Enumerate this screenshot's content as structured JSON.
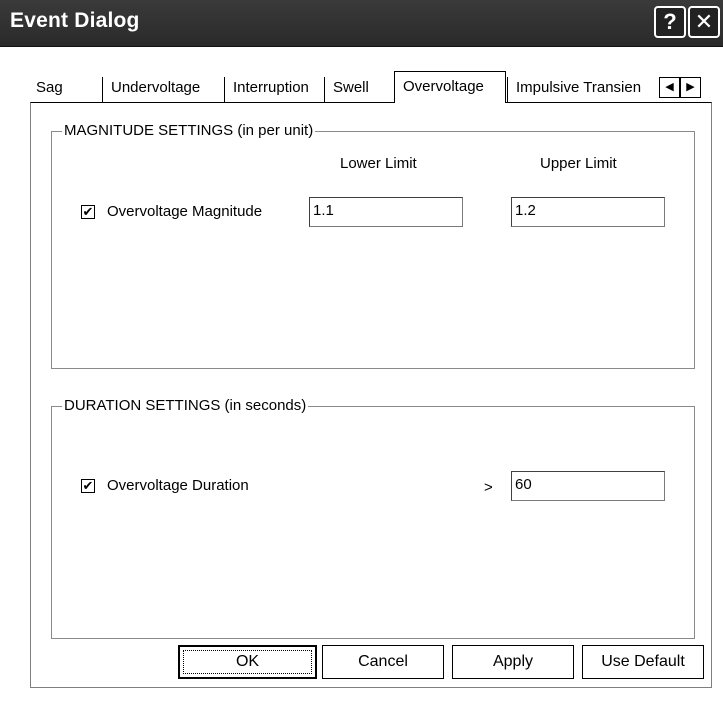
{
  "window": {
    "title": "Event Dialog",
    "help_glyph": "?",
    "close_glyph": "✕"
  },
  "tabs": [
    {
      "label": "Sag",
      "active": false
    },
    {
      "label": "Undervoltage",
      "active": false
    },
    {
      "label": "Interruption",
      "active": false
    },
    {
      "label": "Swell",
      "active": false
    },
    {
      "label": "Overvoltage",
      "active": true
    },
    {
      "label": "Impulsive Transien",
      "active": false
    }
  ],
  "tab_scroll": {
    "left": "◀",
    "right": "▶"
  },
  "magnitude": {
    "legend": "MAGNITUDE SETTINGS (in per unit)",
    "lower_header": "Lower Limit",
    "upper_header": "Upper Limit",
    "checkbox_checked": true,
    "check_glyph": "✔",
    "label": "Overvoltage Magnitude",
    "lower_value": "1.1",
    "upper_value": "1.2"
  },
  "duration": {
    "legend": "DURATION SETTINGS (in seconds)",
    "checkbox_checked": true,
    "check_glyph": "✔",
    "label": "Overvoltage Duration",
    "operator": ">",
    "value": "60"
  },
  "buttons": {
    "ok": "OK",
    "cancel": "Cancel",
    "apply": "Apply",
    "use_default": "Use Default"
  }
}
